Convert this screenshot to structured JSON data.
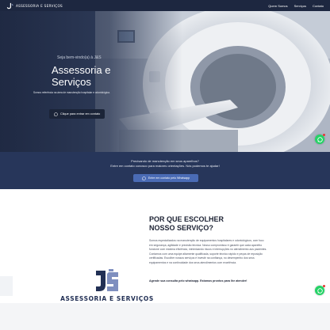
{
  "colors": {
    "nav_bg": "#1d2740",
    "hero_button_bg": "#1b2438",
    "band_bg": "#27365a",
    "band_button_bg": "#4a6bb5",
    "whatsapp_green": "#25d366",
    "notification_red": "#e53935",
    "title_dark": "#1c2233",
    "logo_navy": "#223055"
  },
  "nav": {
    "brand": "ASSESSORIA E SERVIÇOS",
    "links": [
      "Quem Somos",
      "Serviços",
      "Contato"
    ]
  },
  "hero": {
    "welcome": "Seja bem-vindo(a) à J&S",
    "title_line1": "Assessoria e",
    "title_line2": "Serviços",
    "subtitle": "Somos referência na área de manutenção hospitalar e odontológica.",
    "button_label": "Clique para entrar em contato",
    "button_icon": "whatsapp-icon"
  },
  "band": {
    "line1": "Precisando de manutenção em seus aparelhos?",
    "line2": "Entre em contato conosco para maiores orientações. Nós podemos te ajudar!",
    "button_label": "Entre em contato pelo Whatsapp",
    "button_icon": "whatsapp-icon"
  },
  "why": {
    "title_line1": "POR QUE ESCOLHER",
    "title_line2": "NOSSO SERVIÇO?",
    "paragraph": "Somos especializados na manutenção de equipamentos hospitalares e odontológicos, com foco em segurança, agilidade e precisão técnica. Nosso compromisso é garantir que cada aparelho funcione com máxima eficiência, minimizando riscos e interrupções no atendimento aos pacientes. Contamos com uma equipe altamente qualificada, suporte técnico rápido e peças de reposição certificadas. Escolher nossos serviços é investir na confiança, no desempenho dos seus equipamentos e na continuidade dos seus atendimentos com excelência.",
    "cta": "Agende sua consulta pelo whatsapp. Estamos prontos para lhe atender!",
    "logo_text": "ASSESSORIA E SERVIÇOS"
  },
  "floating": {
    "icon": "whatsapp-icon"
  }
}
